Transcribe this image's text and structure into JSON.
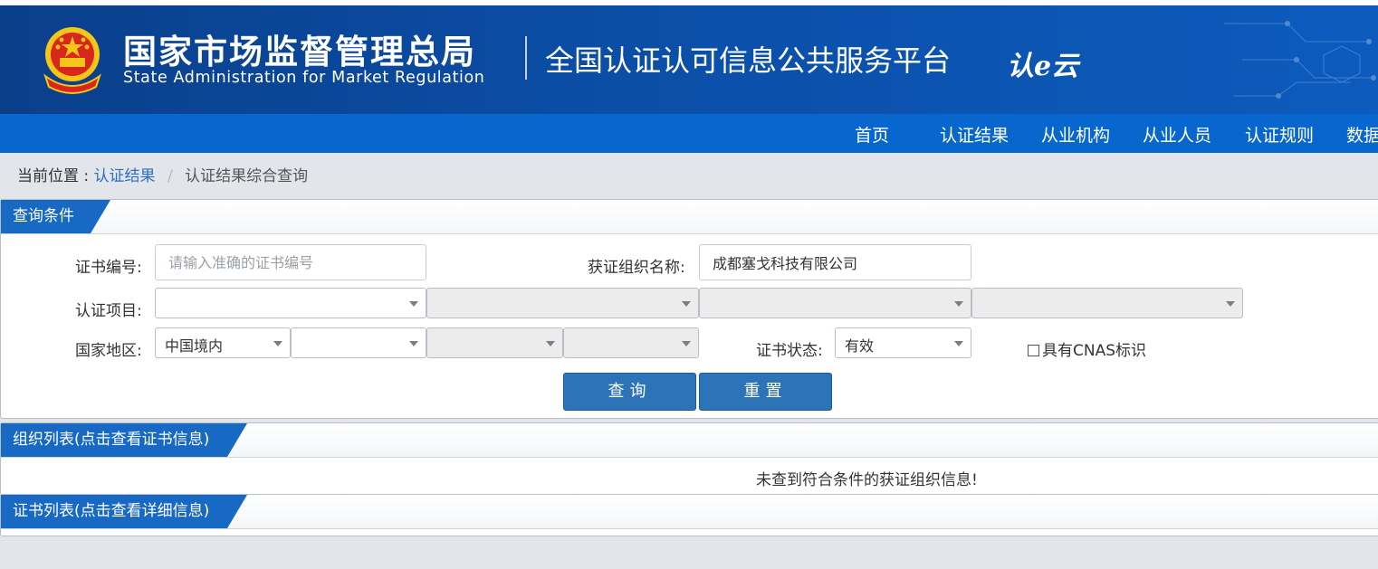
{
  "header": {
    "agency_cn": "国家市场监督管理总局",
    "agency_en": "State Administration  for  Market Regulation",
    "platform_name": "全国认证认可信息公共服务平台",
    "logo_mark": "认e云"
  },
  "nav": {
    "items": [
      "首页",
      "认证结果",
      "从业机构",
      "从业人员",
      "认证规则",
      "数据"
    ]
  },
  "breadcrumb": {
    "prefix": "当前位置 :",
    "link": "认证结果",
    "sep": "/",
    "current": "认证结果综合查询"
  },
  "query": {
    "title": "查询条件",
    "cert_no_label": "证书编号:",
    "cert_no_placeholder": "请输入准确的证书编号",
    "org_name_label": "获证组织名称:",
    "org_name_value": "成都塞戈科技有限公司",
    "project_label": "认证项目:",
    "region_label": "国家地区:",
    "region_value": "中国境内",
    "status_label": "证书状态:",
    "status_value": "有效",
    "cnas_label": "具有CNAS标识",
    "search_button": "查询",
    "reset_button": "重置"
  },
  "org_list": {
    "title": "组织列表(点击查看证书信息)",
    "empty_message": "未查到符合条件的获证组织信息!"
  },
  "cert_list": {
    "title": "证书列表(点击查看详细信息)"
  },
  "colors": {
    "header_blue": "#0b4ea7",
    "nav_blue": "#0867cf",
    "tab_blue": "#1769c4",
    "button_blue": "#2d73b8",
    "link_blue": "#2f6ec2"
  }
}
